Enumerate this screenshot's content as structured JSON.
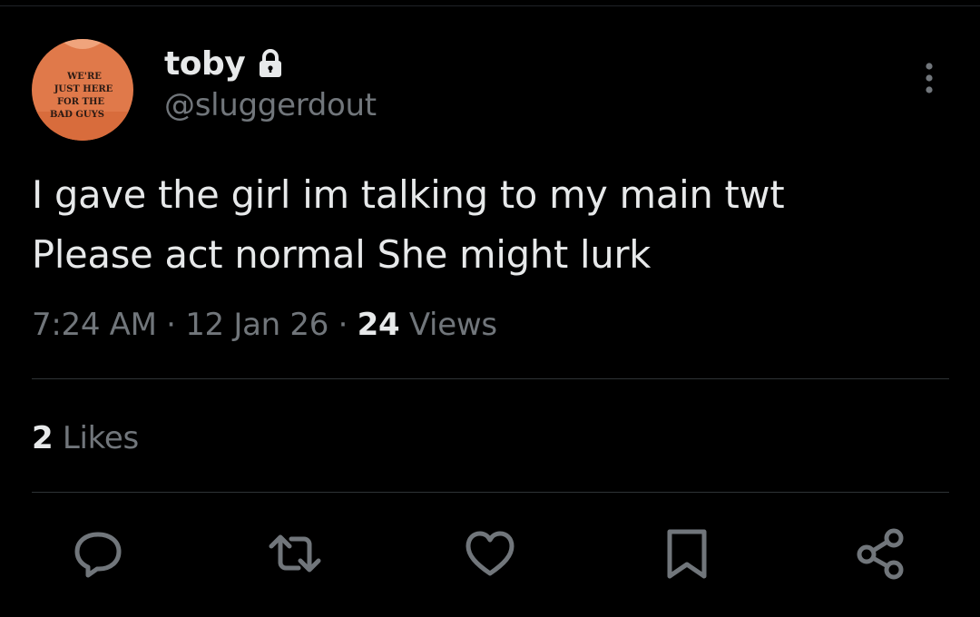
{
  "author": {
    "display_name": "toby",
    "handle": "@sluggerdout",
    "protected_icon": "lock-icon",
    "avatar_shirt_text": [
      "WE'RE",
      "JUST HERE",
      "FOR THE",
      "BAD GUYS"
    ]
  },
  "tweet": {
    "lines": [
      "I gave the girl im talking to my main twt",
      "Please act normal She might lurk"
    ],
    "time": "7:24 AM",
    "separator": "·",
    "date": "12 Jan 26",
    "views_count": "24",
    "views_label": "Views"
  },
  "engagement": {
    "likes_count": "2",
    "likes_label": "Likes"
  },
  "actions": {
    "icons": [
      "reply-icon",
      "retweet-icon",
      "like-icon",
      "bookmark-icon",
      "share-icon"
    ]
  },
  "menu": {
    "icon": "more-options-icon"
  },
  "colors": {
    "background": "#000000",
    "primary_text": "#e7e9ea",
    "secondary_text": "#71767b",
    "divider": "#2f3336",
    "avatar_shirt": "#e0794a"
  }
}
